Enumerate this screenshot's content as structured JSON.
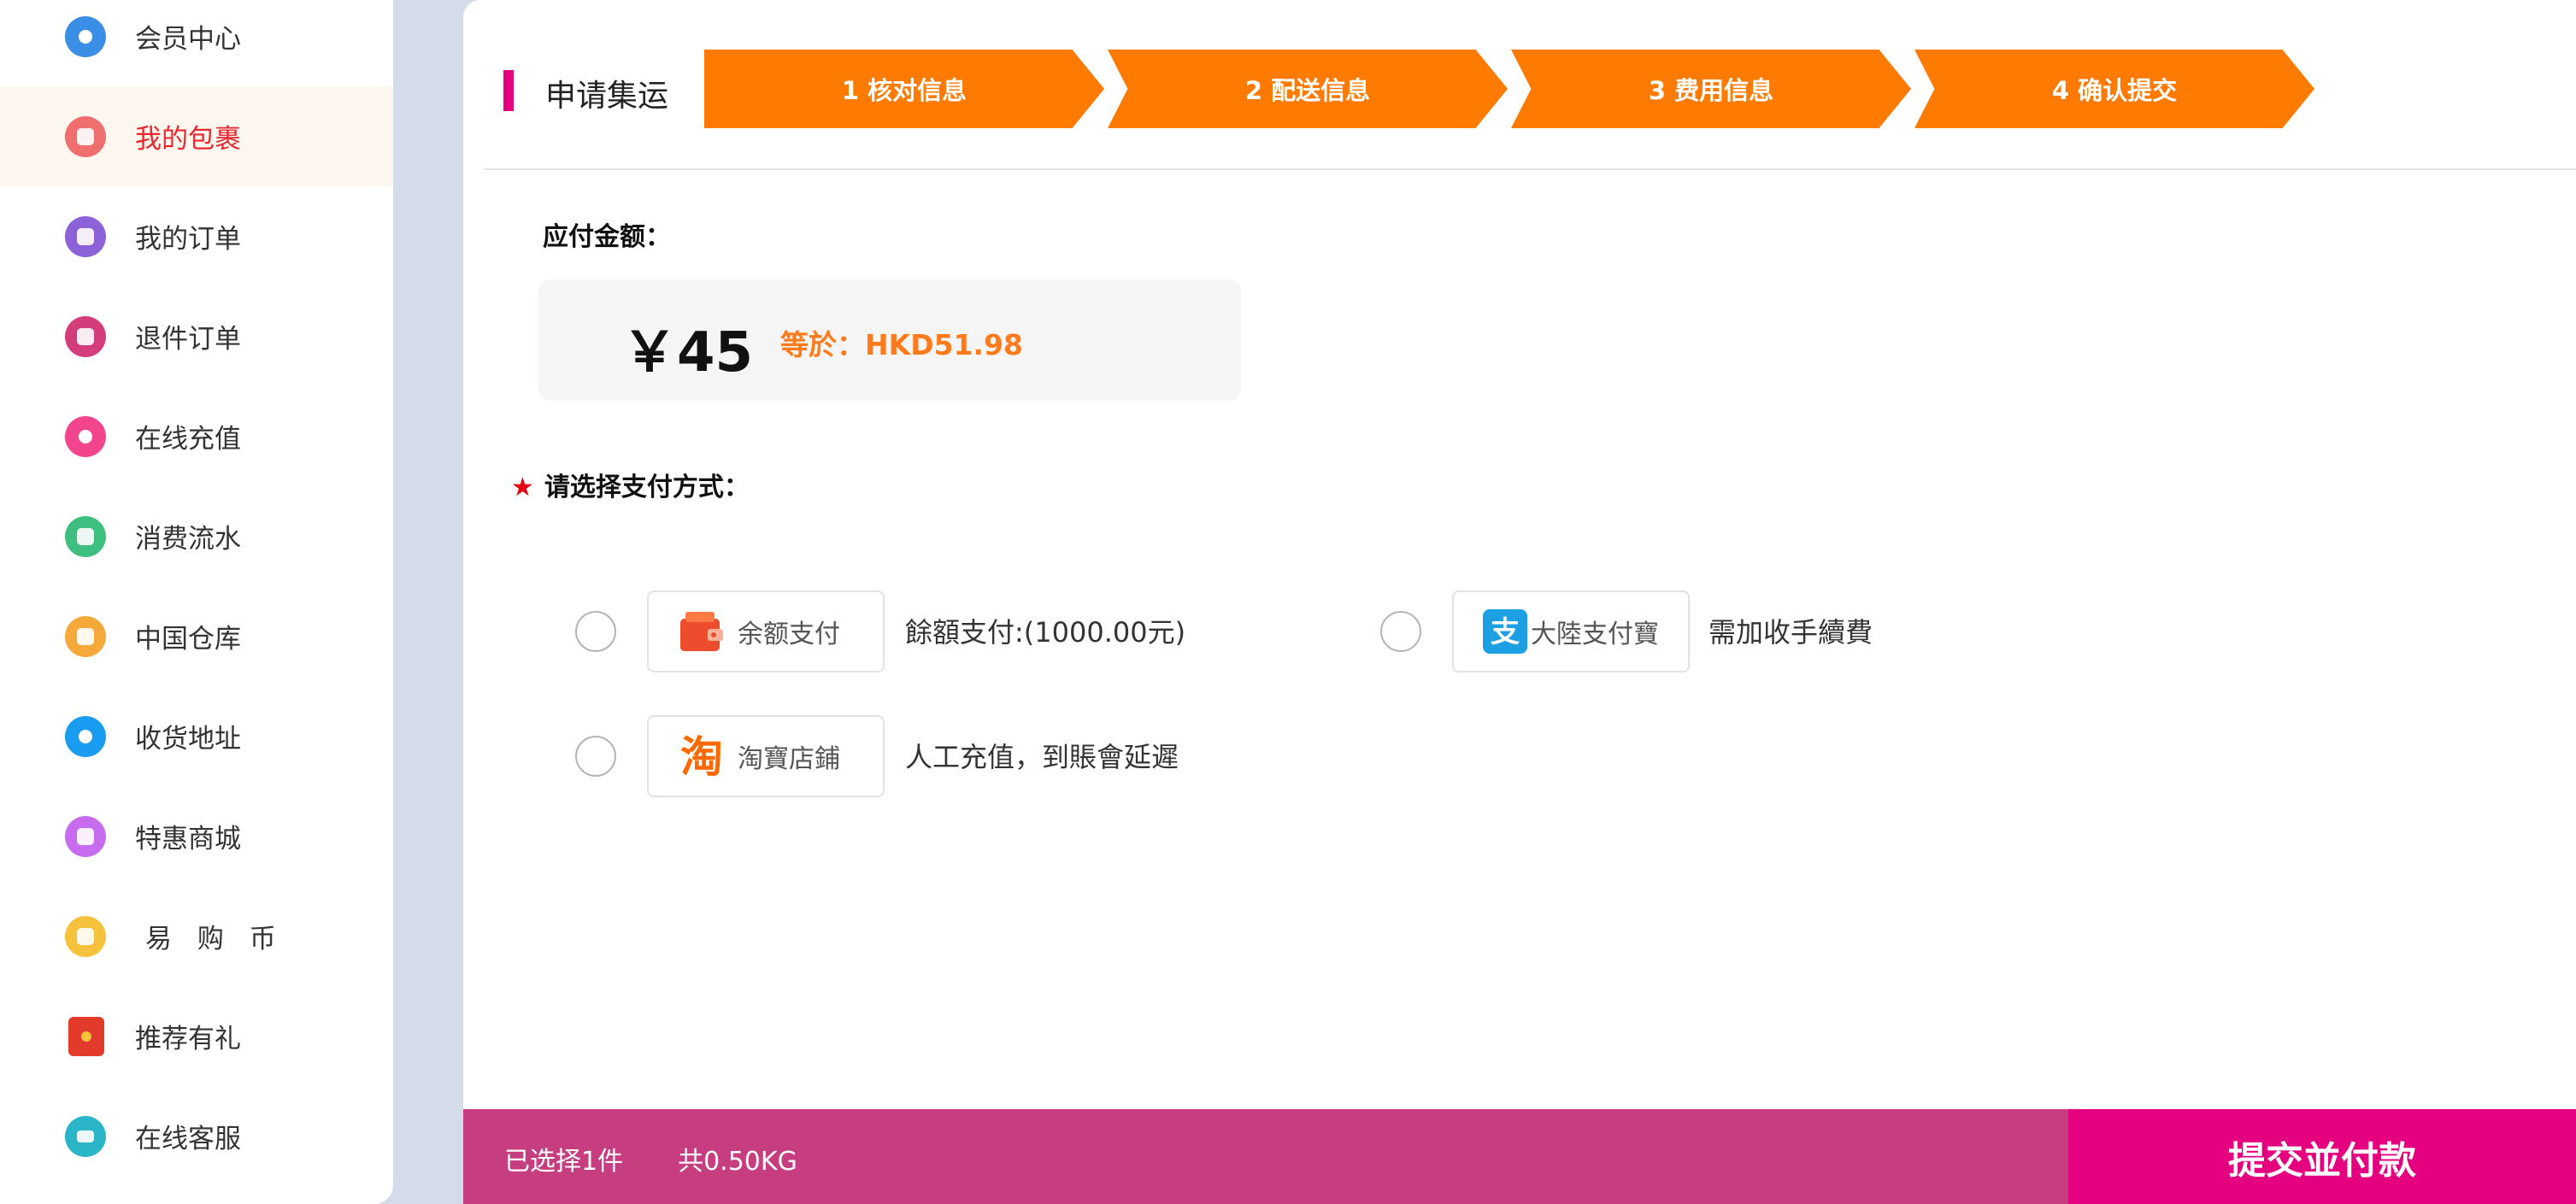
{
  "sidebar": {
    "items": [
      {
        "label": "会员中心",
        "icon": "member-avatar-icon",
        "color": "#3a8ee6"
      },
      {
        "label": "我的包裹",
        "icon": "package-icon",
        "color": "#ef6f6f",
        "active": true
      },
      {
        "label": "我的订单",
        "icon": "order-icon",
        "color": "#8d62d8"
      },
      {
        "label": "退件订单",
        "icon": "return-list-icon",
        "color": "#d43d7c"
      },
      {
        "label": "在线充值",
        "icon": "recharge-icon",
        "color": "#f2458d"
      },
      {
        "label": "消费流水",
        "icon": "consumption-icon",
        "color": "#3fbf7f"
      },
      {
        "label": "中国仓库",
        "icon": "warehouse-icon",
        "color": "#f5a93b"
      },
      {
        "label": "收货地址",
        "icon": "location-icon",
        "color": "#1a9cf0"
      },
      {
        "label": "特惠商城",
        "icon": "shopping-bag-icon",
        "color": "#c76bef"
      },
      {
        "label": "易 购 币",
        "icon": "coin-icon",
        "color": "#f7c23b"
      },
      {
        "label": "推荐有礼",
        "icon": "red-envelope-icon",
        "color": "#e23a2b"
      },
      {
        "label": "在线客服",
        "icon": "chat-icon",
        "color": "#2bb5c9"
      }
    ]
  },
  "page": {
    "title": "申请集运",
    "steps": [
      "1  核对信息",
      "2  配送信息",
      "3  费用信息",
      "4  确认提交"
    ]
  },
  "amount": {
    "label": "应付金额：",
    "value": "￥45",
    "equivalent": "等於：HKD51.98"
  },
  "payment": {
    "label": "请选择支付方式：",
    "required_mark": "★",
    "options": [
      {
        "name": "余额支付",
        "desc": "餘額支付:(1000.00元)",
        "icon": "wallet-icon"
      },
      {
        "name": "大陸支付寶",
        "desc": "需加收手續費",
        "icon": "alipay-icon"
      },
      {
        "name": "淘寶店鋪",
        "desc": "人工充值，到賬會延遲",
        "icon": "taobao-icon"
      }
    ]
  },
  "footer": {
    "selected": "已选择1件",
    "weight": "共0.50KG",
    "submit": "提交並付款"
  },
  "colors": {
    "accent_orange": "#ff7a00",
    "brand_magenta": "#e4007f",
    "footer_bar": "#c73e80",
    "active_text": "#e8272e"
  }
}
